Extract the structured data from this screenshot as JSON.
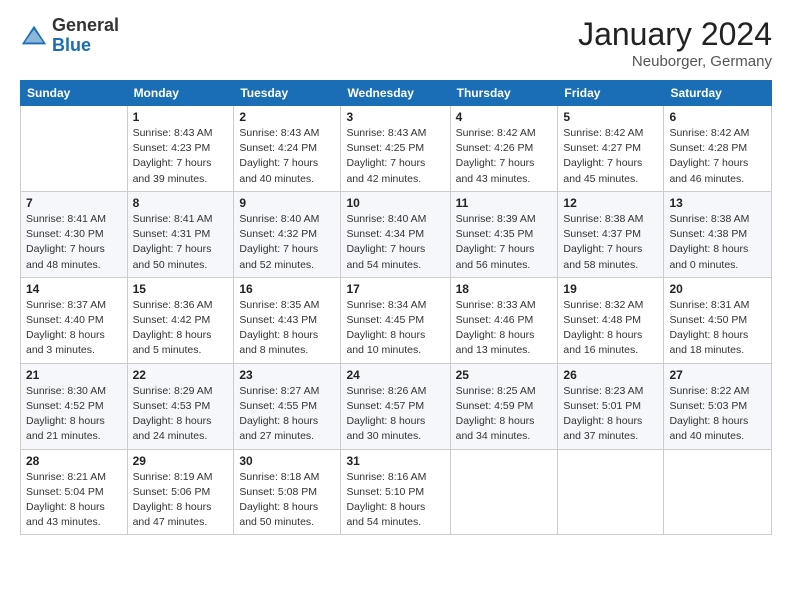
{
  "header": {
    "logo_general": "General",
    "logo_blue": "Blue",
    "month": "January 2024",
    "location": "Neuborger, Germany"
  },
  "days_of_week": [
    "Sunday",
    "Monday",
    "Tuesday",
    "Wednesday",
    "Thursday",
    "Friday",
    "Saturday"
  ],
  "weeks": [
    [
      {
        "num": "",
        "info": ""
      },
      {
        "num": "1",
        "info": "Sunrise: 8:43 AM\nSunset: 4:23 PM\nDaylight: 7 hours\nand 39 minutes."
      },
      {
        "num": "2",
        "info": "Sunrise: 8:43 AM\nSunset: 4:24 PM\nDaylight: 7 hours\nand 40 minutes."
      },
      {
        "num": "3",
        "info": "Sunrise: 8:43 AM\nSunset: 4:25 PM\nDaylight: 7 hours\nand 42 minutes."
      },
      {
        "num": "4",
        "info": "Sunrise: 8:42 AM\nSunset: 4:26 PM\nDaylight: 7 hours\nand 43 minutes."
      },
      {
        "num": "5",
        "info": "Sunrise: 8:42 AM\nSunset: 4:27 PM\nDaylight: 7 hours\nand 45 minutes."
      },
      {
        "num": "6",
        "info": "Sunrise: 8:42 AM\nSunset: 4:28 PM\nDaylight: 7 hours\nand 46 minutes."
      }
    ],
    [
      {
        "num": "7",
        "info": "Sunrise: 8:41 AM\nSunset: 4:30 PM\nDaylight: 7 hours\nand 48 minutes."
      },
      {
        "num": "8",
        "info": "Sunrise: 8:41 AM\nSunset: 4:31 PM\nDaylight: 7 hours\nand 50 minutes."
      },
      {
        "num": "9",
        "info": "Sunrise: 8:40 AM\nSunset: 4:32 PM\nDaylight: 7 hours\nand 52 minutes."
      },
      {
        "num": "10",
        "info": "Sunrise: 8:40 AM\nSunset: 4:34 PM\nDaylight: 7 hours\nand 54 minutes."
      },
      {
        "num": "11",
        "info": "Sunrise: 8:39 AM\nSunset: 4:35 PM\nDaylight: 7 hours\nand 56 minutes."
      },
      {
        "num": "12",
        "info": "Sunrise: 8:38 AM\nSunset: 4:37 PM\nDaylight: 7 hours\nand 58 minutes."
      },
      {
        "num": "13",
        "info": "Sunrise: 8:38 AM\nSunset: 4:38 PM\nDaylight: 8 hours\nand 0 minutes."
      }
    ],
    [
      {
        "num": "14",
        "info": "Sunrise: 8:37 AM\nSunset: 4:40 PM\nDaylight: 8 hours\nand 3 minutes."
      },
      {
        "num": "15",
        "info": "Sunrise: 8:36 AM\nSunset: 4:42 PM\nDaylight: 8 hours\nand 5 minutes."
      },
      {
        "num": "16",
        "info": "Sunrise: 8:35 AM\nSunset: 4:43 PM\nDaylight: 8 hours\nand 8 minutes."
      },
      {
        "num": "17",
        "info": "Sunrise: 8:34 AM\nSunset: 4:45 PM\nDaylight: 8 hours\nand 10 minutes."
      },
      {
        "num": "18",
        "info": "Sunrise: 8:33 AM\nSunset: 4:46 PM\nDaylight: 8 hours\nand 13 minutes."
      },
      {
        "num": "19",
        "info": "Sunrise: 8:32 AM\nSunset: 4:48 PM\nDaylight: 8 hours\nand 16 minutes."
      },
      {
        "num": "20",
        "info": "Sunrise: 8:31 AM\nSunset: 4:50 PM\nDaylight: 8 hours\nand 18 minutes."
      }
    ],
    [
      {
        "num": "21",
        "info": "Sunrise: 8:30 AM\nSunset: 4:52 PM\nDaylight: 8 hours\nand 21 minutes."
      },
      {
        "num": "22",
        "info": "Sunrise: 8:29 AM\nSunset: 4:53 PM\nDaylight: 8 hours\nand 24 minutes."
      },
      {
        "num": "23",
        "info": "Sunrise: 8:27 AM\nSunset: 4:55 PM\nDaylight: 8 hours\nand 27 minutes."
      },
      {
        "num": "24",
        "info": "Sunrise: 8:26 AM\nSunset: 4:57 PM\nDaylight: 8 hours\nand 30 minutes."
      },
      {
        "num": "25",
        "info": "Sunrise: 8:25 AM\nSunset: 4:59 PM\nDaylight: 8 hours\nand 34 minutes."
      },
      {
        "num": "26",
        "info": "Sunrise: 8:23 AM\nSunset: 5:01 PM\nDaylight: 8 hours\nand 37 minutes."
      },
      {
        "num": "27",
        "info": "Sunrise: 8:22 AM\nSunset: 5:03 PM\nDaylight: 8 hours\nand 40 minutes."
      }
    ],
    [
      {
        "num": "28",
        "info": "Sunrise: 8:21 AM\nSunset: 5:04 PM\nDaylight: 8 hours\nand 43 minutes."
      },
      {
        "num": "29",
        "info": "Sunrise: 8:19 AM\nSunset: 5:06 PM\nDaylight: 8 hours\nand 47 minutes."
      },
      {
        "num": "30",
        "info": "Sunrise: 8:18 AM\nSunset: 5:08 PM\nDaylight: 8 hours\nand 50 minutes."
      },
      {
        "num": "31",
        "info": "Sunrise: 8:16 AM\nSunset: 5:10 PM\nDaylight: 8 hours\nand 54 minutes."
      },
      {
        "num": "",
        "info": ""
      },
      {
        "num": "",
        "info": ""
      },
      {
        "num": "",
        "info": ""
      }
    ]
  ]
}
